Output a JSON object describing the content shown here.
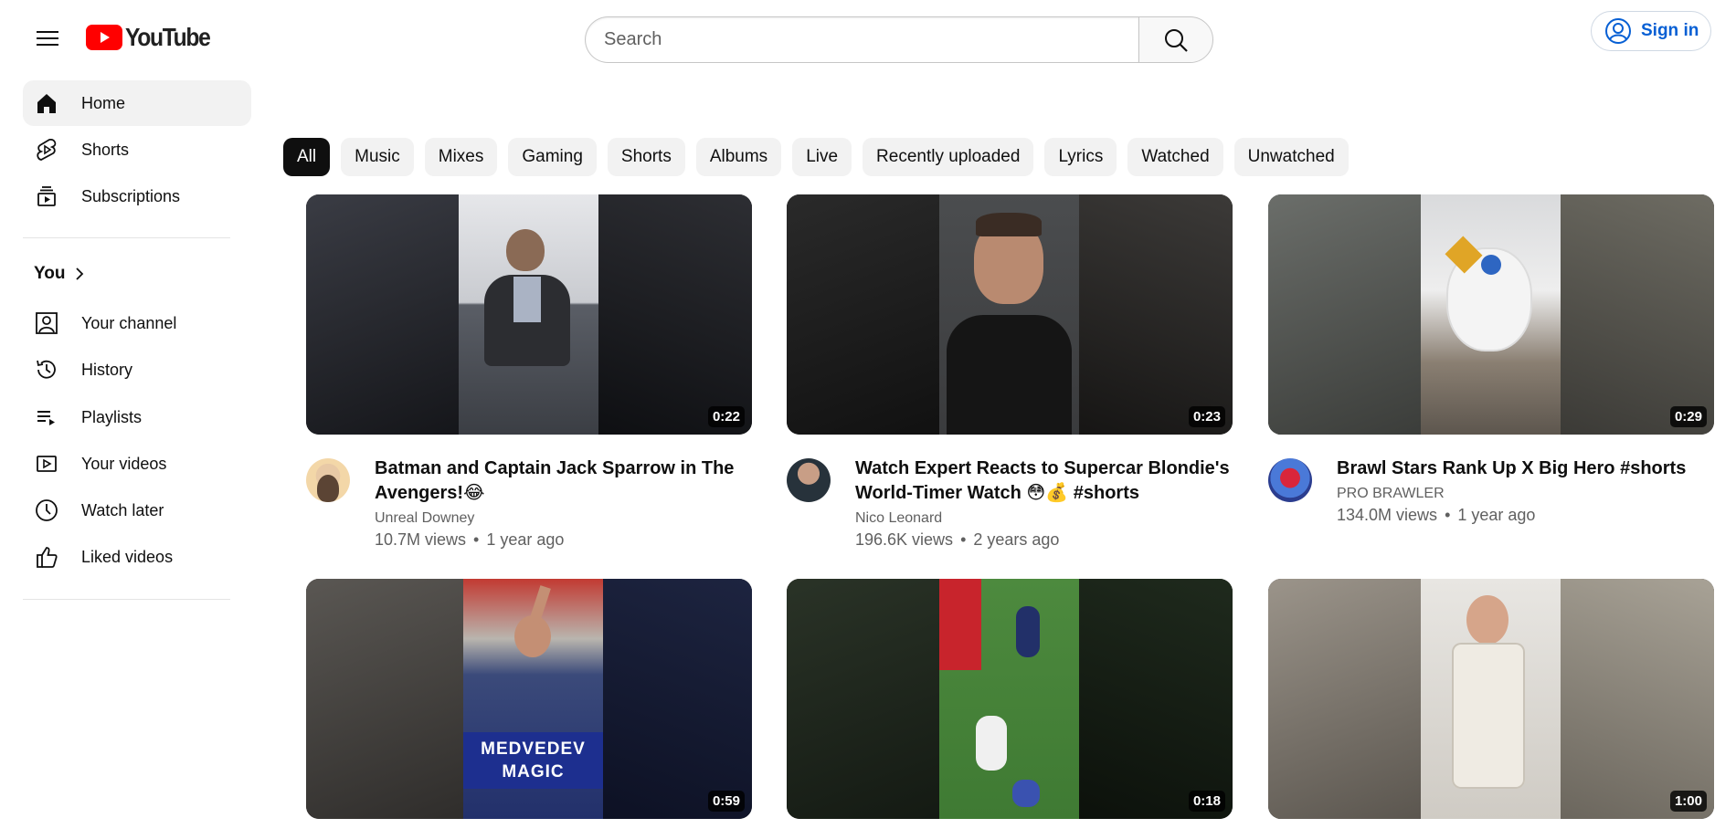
{
  "header": {
    "logo_text": "YouTube",
    "search_placeholder": "Search",
    "signin_label": "Sign in",
    "accent": "#065fd4",
    "brand_red": "#ff0000"
  },
  "sidebar": {
    "items": [
      {
        "label": "Home",
        "icon": "home-icon"
      },
      {
        "label": "Shorts",
        "icon": "shorts-icon"
      },
      {
        "label": "Subscriptions",
        "icon": "subscriptions-icon"
      }
    ],
    "you_heading": "You",
    "you_items": [
      {
        "label": "Your channel",
        "icon": "your-channel-icon"
      },
      {
        "label": "History",
        "icon": "history-icon"
      },
      {
        "label": "Playlists",
        "icon": "playlists-icon"
      },
      {
        "label": "Your videos",
        "icon": "your-videos-icon"
      },
      {
        "label": "Watch later",
        "icon": "watch-later-icon"
      },
      {
        "label": "Liked videos",
        "icon": "liked-videos-icon"
      }
    ]
  },
  "chips": [
    "All",
    "Music",
    "Mixes",
    "Gaming",
    "Shorts",
    "Albums",
    "Live",
    "Recently uploaded",
    "Lyrics",
    "Watched",
    "Unwatched"
  ],
  "videos": [
    {
      "title": "Batman and Captain Jack Sparrow in The Avengers!😂",
      "channel": "Unreal Downey",
      "views": "10.7M views",
      "age": "1 year ago",
      "duration": "0:22"
    },
    {
      "title": "Watch Expert Reacts to Supercar Blondie's World-Timer Watch 😳💰 #shorts",
      "channel": "Nico Leonard",
      "views": "196.6K views",
      "age": "2 years ago",
      "duration": "0:23"
    },
    {
      "title": "Brawl Stars Rank Up X Big Hero #shorts",
      "channel": "PRO BRAWLER",
      "views": "134.0M views",
      "age": "1 year ago",
      "duration": "0:29"
    },
    {
      "title": "",
      "channel": "",
      "views": "",
      "age": "",
      "duration": "0:59",
      "overlay": "MEDVEDEV MAGIC"
    },
    {
      "title": "",
      "channel": "",
      "views": "",
      "age": "",
      "duration": "0:18"
    },
    {
      "title": "",
      "channel": "",
      "views": "",
      "age": "",
      "duration": "1:00"
    }
  ]
}
